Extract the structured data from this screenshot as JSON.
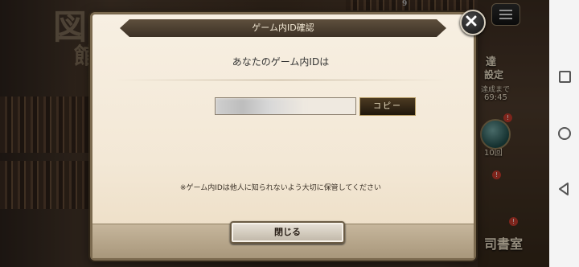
{
  "dialog": {
    "title": "ゲーム内ID確認",
    "prompt": "あなたのゲーム内IDは",
    "id_value": "",
    "copy_label": "コピー",
    "notice": "※ゲーム内IDは他人に知られないよう大切に保管してください",
    "close_label": "閉じる"
  },
  "background": {
    "kanji_top": "図",
    "kanji_second": "館",
    "side_label_1": "達",
    "side_label_2": "設定",
    "side_small_1": "達成まで",
    "side_small_2": "69:45",
    "side_count": "10回",
    "side_bottom": "司書室",
    "badge": "!",
    "top_number": "9"
  },
  "colors": {
    "dialog_bg": "#f3e8d6",
    "ribbon": "#3c3125",
    "copy_button": "#1f170c"
  }
}
